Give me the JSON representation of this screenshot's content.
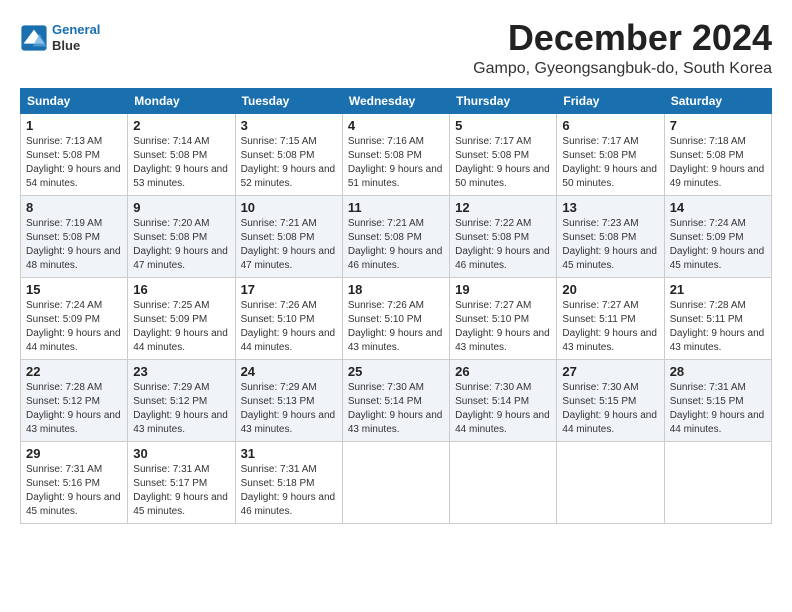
{
  "header": {
    "logo_line1": "General",
    "logo_line2": "Blue",
    "month": "December 2024",
    "location": "Gampo, Gyeongsangbuk-do, South Korea"
  },
  "weekdays": [
    "Sunday",
    "Monday",
    "Tuesday",
    "Wednesday",
    "Thursday",
    "Friday",
    "Saturday"
  ],
  "weeks": [
    [
      {
        "day": "1",
        "sunrise": "7:13 AM",
        "sunset": "5:08 PM",
        "daylight": "9 hours and 54 minutes."
      },
      {
        "day": "2",
        "sunrise": "7:14 AM",
        "sunset": "5:08 PM",
        "daylight": "9 hours and 53 minutes."
      },
      {
        "day": "3",
        "sunrise": "7:15 AM",
        "sunset": "5:08 PM",
        "daylight": "9 hours and 52 minutes."
      },
      {
        "day": "4",
        "sunrise": "7:16 AM",
        "sunset": "5:08 PM",
        "daylight": "9 hours and 51 minutes."
      },
      {
        "day": "5",
        "sunrise": "7:17 AM",
        "sunset": "5:08 PM",
        "daylight": "9 hours and 50 minutes."
      },
      {
        "day": "6",
        "sunrise": "7:17 AM",
        "sunset": "5:08 PM",
        "daylight": "9 hours and 50 minutes."
      },
      {
        "day": "7",
        "sunrise": "7:18 AM",
        "sunset": "5:08 PM",
        "daylight": "9 hours and 49 minutes."
      }
    ],
    [
      {
        "day": "8",
        "sunrise": "7:19 AM",
        "sunset": "5:08 PM",
        "daylight": "9 hours and 48 minutes."
      },
      {
        "day": "9",
        "sunrise": "7:20 AM",
        "sunset": "5:08 PM",
        "daylight": "9 hours and 47 minutes."
      },
      {
        "day": "10",
        "sunrise": "7:21 AM",
        "sunset": "5:08 PM",
        "daylight": "9 hours and 47 minutes."
      },
      {
        "day": "11",
        "sunrise": "7:21 AM",
        "sunset": "5:08 PM",
        "daylight": "9 hours and 46 minutes."
      },
      {
        "day": "12",
        "sunrise": "7:22 AM",
        "sunset": "5:08 PM",
        "daylight": "9 hours and 46 minutes."
      },
      {
        "day": "13",
        "sunrise": "7:23 AM",
        "sunset": "5:08 PM",
        "daylight": "9 hours and 45 minutes."
      },
      {
        "day": "14",
        "sunrise": "7:24 AM",
        "sunset": "5:09 PM",
        "daylight": "9 hours and 45 minutes."
      }
    ],
    [
      {
        "day": "15",
        "sunrise": "7:24 AM",
        "sunset": "5:09 PM",
        "daylight": "9 hours and 44 minutes."
      },
      {
        "day": "16",
        "sunrise": "7:25 AM",
        "sunset": "5:09 PM",
        "daylight": "9 hours and 44 minutes."
      },
      {
        "day": "17",
        "sunrise": "7:26 AM",
        "sunset": "5:10 PM",
        "daylight": "9 hours and 44 minutes."
      },
      {
        "day": "18",
        "sunrise": "7:26 AM",
        "sunset": "5:10 PM",
        "daylight": "9 hours and 43 minutes."
      },
      {
        "day": "19",
        "sunrise": "7:27 AM",
        "sunset": "5:10 PM",
        "daylight": "9 hours and 43 minutes."
      },
      {
        "day": "20",
        "sunrise": "7:27 AM",
        "sunset": "5:11 PM",
        "daylight": "9 hours and 43 minutes."
      },
      {
        "day": "21",
        "sunrise": "7:28 AM",
        "sunset": "5:11 PM",
        "daylight": "9 hours and 43 minutes."
      }
    ],
    [
      {
        "day": "22",
        "sunrise": "7:28 AM",
        "sunset": "5:12 PM",
        "daylight": "9 hours and 43 minutes."
      },
      {
        "day": "23",
        "sunrise": "7:29 AM",
        "sunset": "5:12 PM",
        "daylight": "9 hours and 43 minutes."
      },
      {
        "day": "24",
        "sunrise": "7:29 AM",
        "sunset": "5:13 PM",
        "daylight": "9 hours and 43 minutes."
      },
      {
        "day": "25",
        "sunrise": "7:30 AM",
        "sunset": "5:14 PM",
        "daylight": "9 hours and 43 minutes."
      },
      {
        "day": "26",
        "sunrise": "7:30 AM",
        "sunset": "5:14 PM",
        "daylight": "9 hours and 44 minutes."
      },
      {
        "day": "27",
        "sunrise": "7:30 AM",
        "sunset": "5:15 PM",
        "daylight": "9 hours and 44 minutes."
      },
      {
        "day": "28",
        "sunrise": "7:31 AM",
        "sunset": "5:15 PM",
        "daylight": "9 hours and 44 minutes."
      }
    ],
    [
      {
        "day": "29",
        "sunrise": "7:31 AM",
        "sunset": "5:16 PM",
        "daylight": "9 hours and 45 minutes."
      },
      {
        "day": "30",
        "sunrise": "7:31 AM",
        "sunset": "5:17 PM",
        "daylight": "9 hours and 45 minutes."
      },
      {
        "day": "31",
        "sunrise": "7:31 AM",
        "sunset": "5:18 PM",
        "daylight": "9 hours and 46 minutes."
      },
      null,
      null,
      null,
      null
    ]
  ]
}
